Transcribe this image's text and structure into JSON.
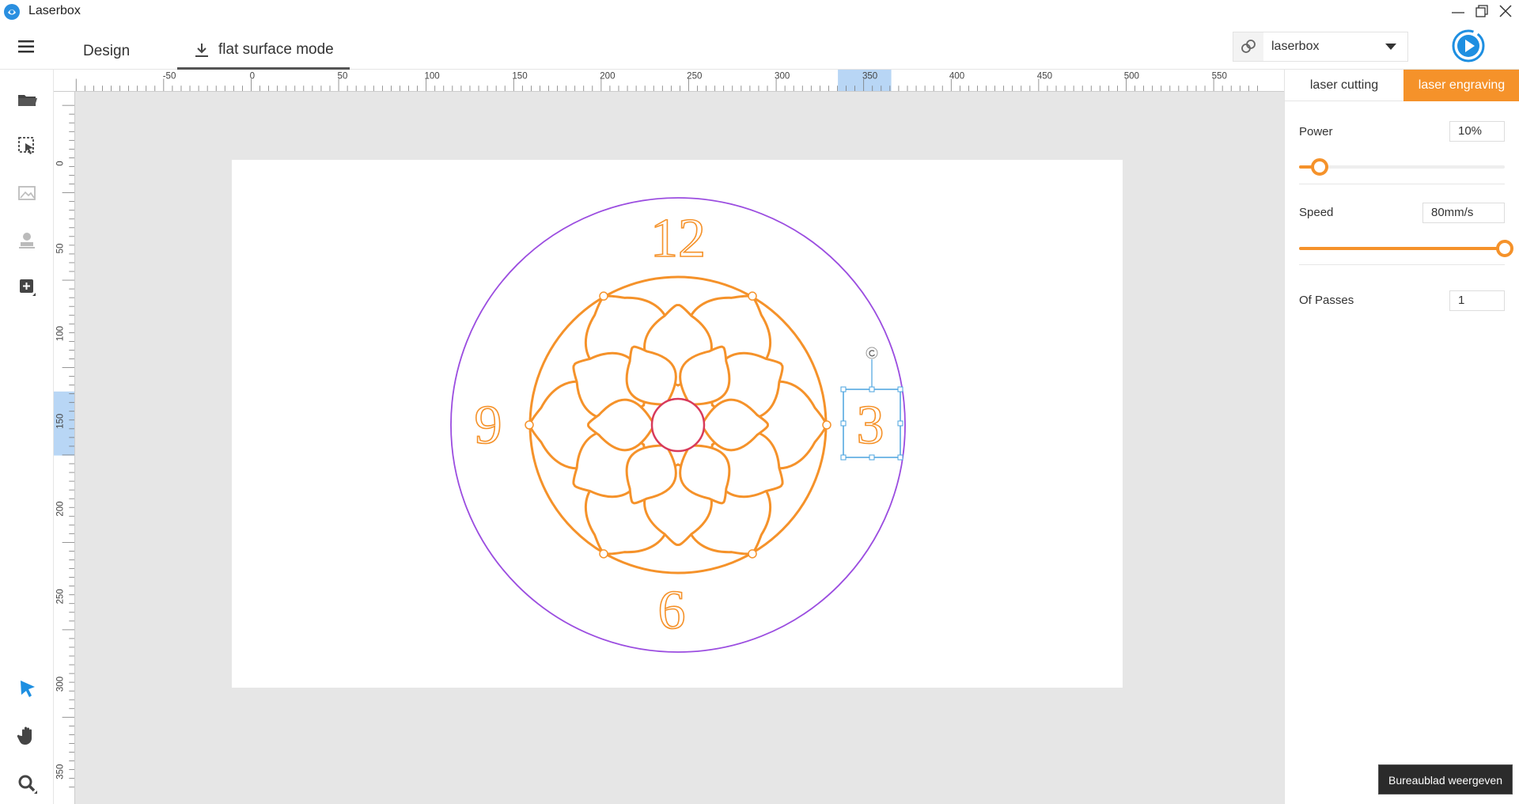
{
  "app": {
    "title": "Laserbox"
  },
  "header": {
    "tabs": [
      {
        "label": "Design",
        "active": false
      },
      {
        "label": "flat surface mode",
        "active": true
      }
    ],
    "device": {
      "name": "laserbox"
    }
  },
  "toolbar": {
    "tools": [
      {
        "name": "open-folder-icon"
      },
      {
        "name": "select-region-icon"
      },
      {
        "name": "image-icon"
      },
      {
        "name": "stamp-icon"
      },
      {
        "name": "add-shape-icon"
      },
      {
        "name": "pointer-icon",
        "active": true
      },
      {
        "name": "hand-pan-icon"
      },
      {
        "name": "zoom-icon"
      }
    ]
  },
  "ruler": {
    "top_labels": [
      "-50",
      "0",
      "50",
      "100",
      "150",
      "200",
      "250",
      "300",
      "350",
      "400",
      "450",
      "500",
      "550"
    ],
    "left_labels": [
      "0",
      "50",
      "100",
      "150",
      "200",
      "250",
      "300",
      "350"
    ]
  },
  "canvas": {
    "clock_numbers": {
      "twelve": "12",
      "nine": "9",
      "three": "3",
      "six": "6"
    }
  },
  "panel": {
    "mode_tabs": {
      "cutting": "laser cutting",
      "engraving": "laser engraving"
    },
    "active_mode": "laser engraving",
    "power": {
      "label": "Power",
      "value": "10%",
      "fraction": 0.1
    },
    "speed": {
      "label": "Speed",
      "value": "80mm/s",
      "fraction": 1.0
    },
    "passes": {
      "label": "Of Passes",
      "value": "1"
    }
  },
  "tooltip": {
    "text": "Bureaublad weergeven"
  },
  "colors": {
    "accent": "#f5922a",
    "outline_circle": "#9b4de0",
    "selection": "#4aa3df",
    "active_tool": "#1e8fe1",
    "center_circle": "#d83a5a"
  }
}
